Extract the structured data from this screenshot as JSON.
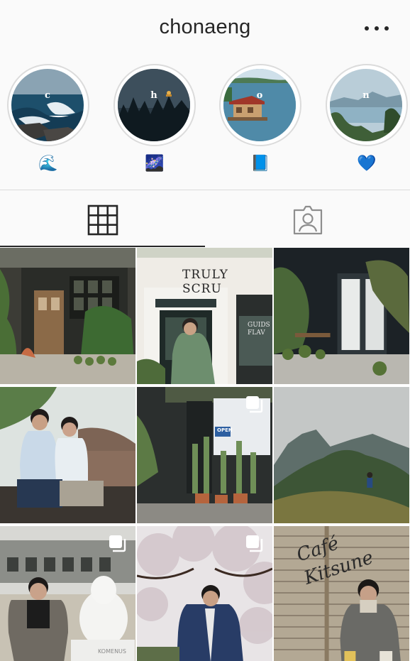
{
  "header": {
    "username": "chonaeng",
    "more_icon": "more-horizontal-icon"
  },
  "highlights": [
    {
      "letter": "c",
      "emoji": "🌊",
      "theme": "ocean-waves"
    },
    {
      "letter": "h",
      "emoji": "🌌",
      "theme": "night-forest"
    },
    {
      "letter": "o",
      "emoji": "📘",
      "theme": "lake-house"
    },
    {
      "letter": "n",
      "emoji": "💙",
      "theme": "mountain-lake"
    }
  ],
  "tabs": [
    {
      "name": "grid",
      "icon": "grid-icon",
      "active": true
    },
    {
      "name": "tagged",
      "icon": "tagged-person-icon",
      "active": false
    }
  ],
  "colors": {
    "text": "#262626",
    "border": "#dbdbdb",
    "background": "#fafafa",
    "heart": "#1e88e5"
  },
  "posts": [
    {
      "id": 1,
      "subject": "green cafe storefront with plants",
      "multi": false
    },
    {
      "id": 2,
      "subject": "person in front of cafe",
      "multi": false,
      "sign_text": "TRULY SCRU",
      "sign_text2": "GUIDS FLAV"
    },
    {
      "id": 3,
      "subject": "dark wall with plants",
      "multi": false
    },
    {
      "id": 4,
      "subject": "two people sitting outdoors",
      "multi": false
    },
    {
      "id": 5,
      "subject": "cafe entrance with cactus plants",
      "multi": true,
      "sign_text": "OPEN"
    },
    {
      "id": 6,
      "subject": "person on mountain ridge",
      "multi": false
    },
    {
      "id": 7,
      "subject": "person with moomin statue",
      "multi": true,
      "statue_text": "KOMENUS"
    },
    {
      "id": 8,
      "subject": "person under cherry blossoms",
      "multi": true
    },
    {
      "id": 9,
      "subject": "person by bamboo wall sign",
      "multi": false,
      "wall_text": "Café Kitsune"
    }
  ]
}
